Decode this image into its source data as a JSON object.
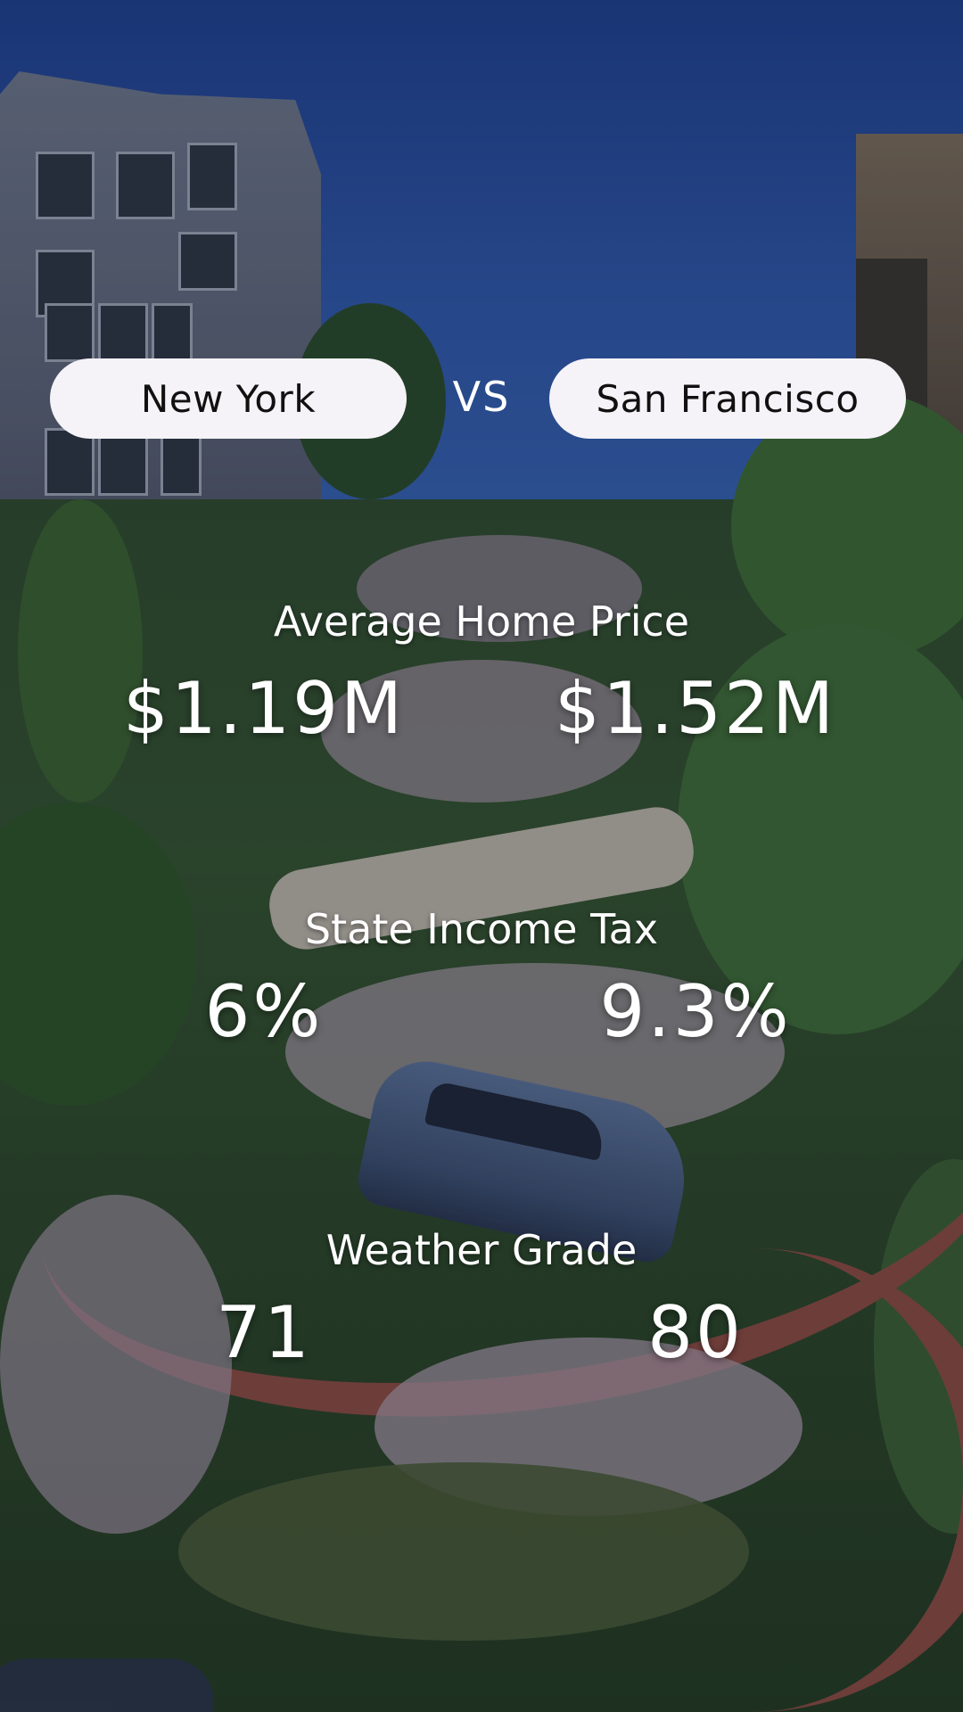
{
  "comparison": {
    "left_city": "New York",
    "separator": "VS",
    "right_city": "San Francisco"
  },
  "stats": [
    {
      "title": "Average Home Price",
      "left_value": "$1.19M",
      "right_value": "$1.52M"
    },
    {
      "title": "State Income Tax",
      "left_value": "6%",
      "right_value": "9.3%"
    },
    {
      "title": "Weather Grade",
      "left_value": "71",
      "right_value": "80"
    }
  ],
  "colors": {
    "pill_background": "#f5f3f7",
    "pill_text": "#111111",
    "overlay_text": "#ffffff"
  }
}
